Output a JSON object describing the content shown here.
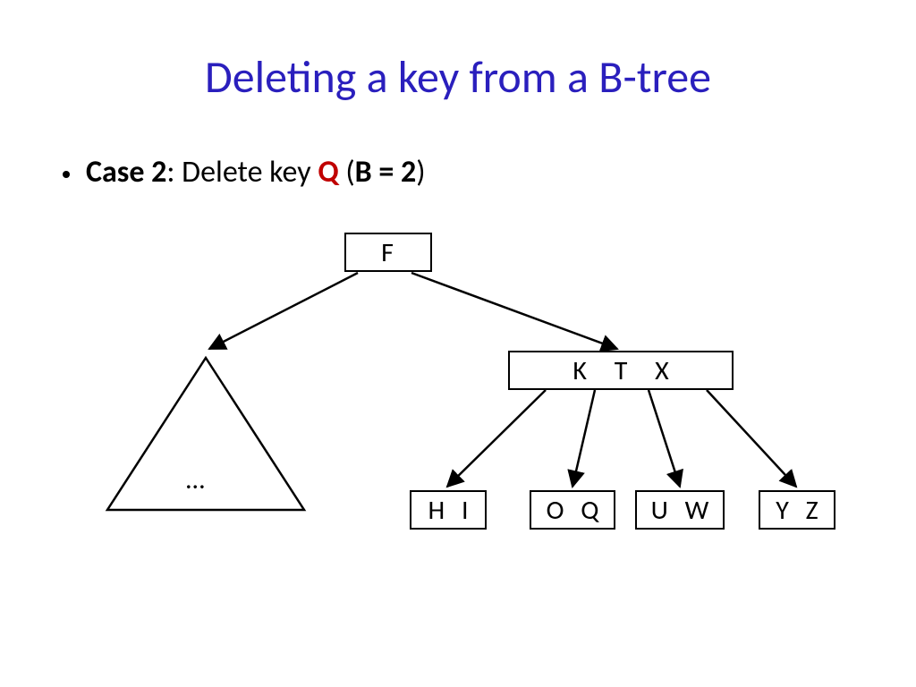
{
  "title": "Deleting a key from a B-tree",
  "bullet": {
    "case_label": "Case 2",
    "colon_text": ": Delete key ",
    "key": "Q",
    "paren_open": "  (",
    "b_text": "B = 2",
    "paren_close": ")"
  },
  "nodes": {
    "root": "F",
    "right_internal": "K T X",
    "ellipsis": "…",
    "leaf1": "H I",
    "leaf2": "O Q",
    "leaf3": "U W",
    "leaf4": "Y Z"
  }
}
